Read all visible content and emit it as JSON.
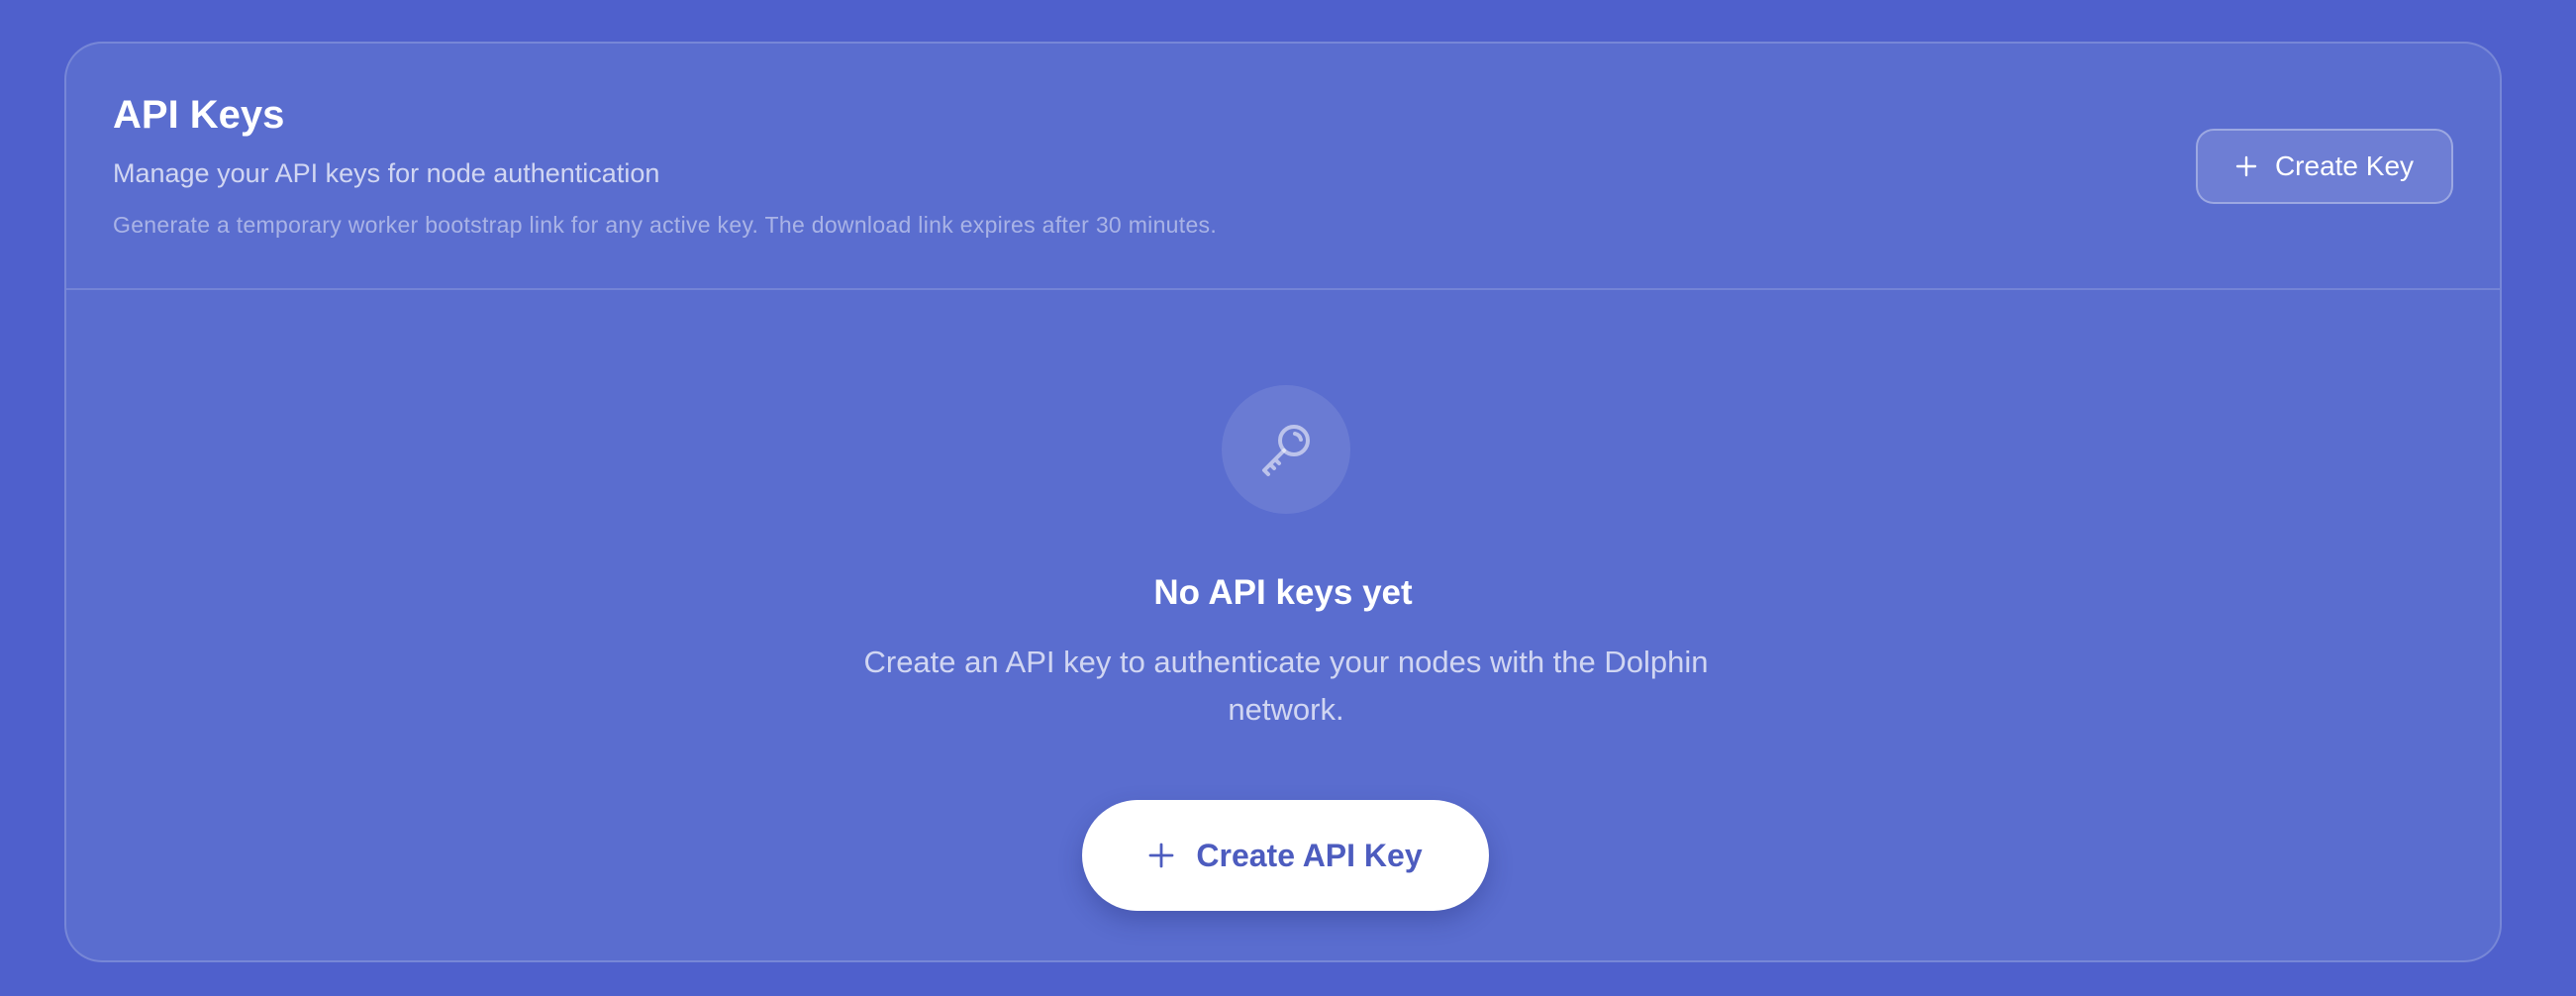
{
  "header": {
    "title": "API Keys",
    "subtitle": "Manage your API keys for node authentication",
    "note": "Generate a temporary worker bootstrap link for any active key. The download link expires after 30 minutes.",
    "create_button_label": "Create Key",
    "create_button_icon": "plus-icon"
  },
  "empty_state": {
    "icon": "key-icon",
    "title": "No API keys yet",
    "description_line1": "Create an API key to authenticate your nodes with the Dolphin",
    "description_line2": "network.",
    "create_button_label": "Create API Key",
    "create_button_icon": "plus-icon"
  },
  "colors": {
    "background": "#4f60cc",
    "card": "#5a6dcf",
    "primary_button_text": "#4d5cbf",
    "primary_button_bg": "#ffffff"
  }
}
